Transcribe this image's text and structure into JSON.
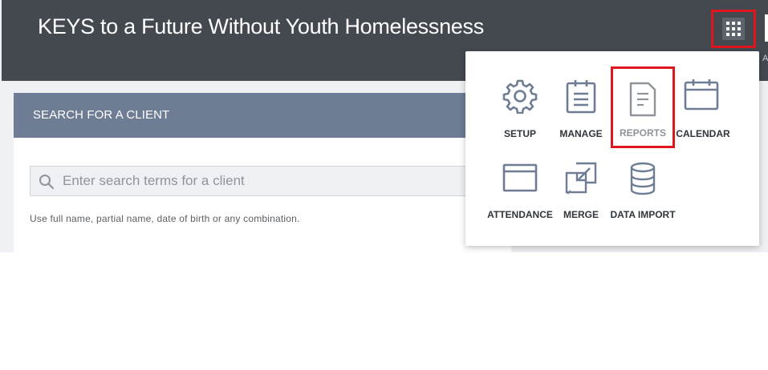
{
  "header": {
    "title": "KEYS to a Future Without Youth Homelessness",
    "apps_icon": "grid-icon",
    "edge_text": "AR"
  },
  "search_card": {
    "title": "SEARCH FOR A CLIENT",
    "search_icon": "search-icon",
    "placeholder": "Enter search terms for a client",
    "hint": "Use full name, partial name, date of birth or any combination."
  },
  "apps_menu": {
    "items": [
      {
        "label": "SETUP",
        "icon": "gear-icon"
      },
      {
        "label": "MANAGE",
        "icon": "clipboard-icon"
      },
      {
        "label": "REPORTS",
        "icon": "document-icon"
      },
      {
        "label": "CALENDAR",
        "icon": "calendar-icon"
      },
      {
        "label": "ATTENDANCE",
        "icon": "browser-window-icon"
      },
      {
        "label": "MERGE",
        "icon": "merge-icon"
      },
      {
        "label": "DATA IMPORT",
        "icon": "database-icon"
      }
    ]
  },
  "colors": {
    "header_bg": "#444950",
    "card_header_bg": "#6e7c94",
    "highlight": "#e0161f",
    "icon": "#6e7c94"
  }
}
